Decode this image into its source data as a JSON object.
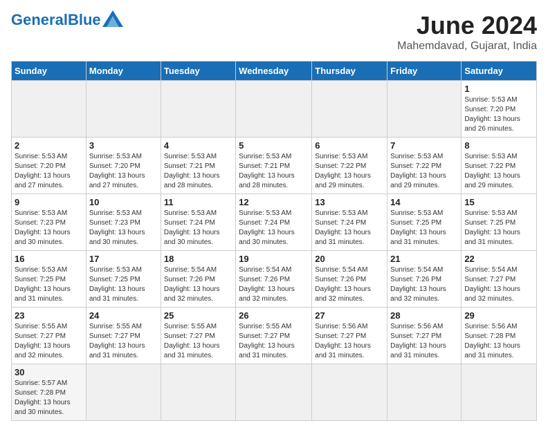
{
  "header": {
    "logo_general": "General",
    "logo_blue": "Blue",
    "month_title": "June 2024",
    "subtitle": "Mahemdavad, Gujarat, India"
  },
  "days_of_week": [
    "Sunday",
    "Monday",
    "Tuesday",
    "Wednesday",
    "Thursday",
    "Friday",
    "Saturday"
  ],
  "weeks": [
    [
      {
        "day": "",
        "info": ""
      },
      {
        "day": "",
        "info": ""
      },
      {
        "day": "",
        "info": ""
      },
      {
        "day": "",
        "info": ""
      },
      {
        "day": "",
        "info": ""
      },
      {
        "day": "",
        "info": ""
      },
      {
        "day": "1",
        "info": "Sunrise: 5:53 AM\nSunset: 7:20 PM\nDaylight: 13 hours\nand 26 minutes."
      }
    ],
    [
      {
        "day": "2",
        "info": "Sunrise: 5:53 AM\nSunset: 7:20 PM\nDaylight: 13 hours\nand 27 minutes."
      },
      {
        "day": "3",
        "info": "Sunrise: 5:53 AM\nSunset: 7:20 PM\nDaylight: 13 hours\nand 27 minutes."
      },
      {
        "day": "4",
        "info": "Sunrise: 5:53 AM\nSunset: 7:21 PM\nDaylight: 13 hours\nand 28 minutes."
      },
      {
        "day": "5",
        "info": "Sunrise: 5:53 AM\nSunset: 7:21 PM\nDaylight: 13 hours\nand 28 minutes."
      },
      {
        "day": "6",
        "info": "Sunrise: 5:53 AM\nSunset: 7:22 PM\nDaylight: 13 hours\nand 29 minutes."
      },
      {
        "day": "7",
        "info": "Sunrise: 5:53 AM\nSunset: 7:22 PM\nDaylight: 13 hours\nand 29 minutes."
      },
      {
        "day": "8",
        "info": "Sunrise: 5:53 AM\nSunset: 7:22 PM\nDaylight: 13 hours\nand 29 minutes."
      }
    ],
    [
      {
        "day": "9",
        "info": "Sunrise: 5:53 AM\nSunset: 7:23 PM\nDaylight: 13 hours\nand 30 minutes."
      },
      {
        "day": "10",
        "info": "Sunrise: 5:53 AM\nSunset: 7:23 PM\nDaylight: 13 hours\nand 30 minutes."
      },
      {
        "day": "11",
        "info": "Sunrise: 5:53 AM\nSunset: 7:24 PM\nDaylight: 13 hours\nand 30 minutes."
      },
      {
        "day": "12",
        "info": "Sunrise: 5:53 AM\nSunset: 7:24 PM\nDaylight: 13 hours\nand 30 minutes."
      },
      {
        "day": "13",
        "info": "Sunrise: 5:53 AM\nSunset: 7:24 PM\nDaylight: 13 hours\nand 31 minutes."
      },
      {
        "day": "14",
        "info": "Sunrise: 5:53 AM\nSunset: 7:25 PM\nDaylight: 13 hours\nand 31 minutes."
      },
      {
        "day": "15",
        "info": "Sunrise: 5:53 AM\nSunset: 7:25 PM\nDaylight: 13 hours\nand 31 minutes."
      }
    ],
    [
      {
        "day": "16",
        "info": "Sunrise: 5:53 AM\nSunset: 7:25 PM\nDaylight: 13 hours\nand 31 minutes."
      },
      {
        "day": "17",
        "info": "Sunrise: 5:53 AM\nSunset: 7:25 PM\nDaylight: 13 hours\nand 31 minutes."
      },
      {
        "day": "18",
        "info": "Sunrise: 5:54 AM\nSunset: 7:26 PM\nDaylight: 13 hours\nand 32 minutes."
      },
      {
        "day": "19",
        "info": "Sunrise: 5:54 AM\nSunset: 7:26 PM\nDaylight: 13 hours\nand 32 minutes."
      },
      {
        "day": "20",
        "info": "Sunrise: 5:54 AM\nSunset: 7:26 PM\nDaylight: 13 hours\nand 32 minutes."
      },
      {
        "day": "21",
        "info": "Sunrise: 5:54 AM\nSunset: 7:26 PM\nDaylight: 13 hours\nand 32 minutes."
      },
      {
        "day": "22",
        "info": "Sunrise: 5:54 AM\nSunset: 7:27 PM\nDaylight: 13 hours\nand 32 minutes."
      }
    ],
    [
      {
        "day": "23",
        "info": "Sunrise: 5:55 AM\nSunset: 7:27 PM\nDaylight: 13 hours\nand 32 minutes."
      },
      {
        "day": "24",
        "info": "Sunrise: 5:55 AM\nSunset: 7:27 PM\nDaylight: 13 hours\nand 31 minutes."
      },
      {
        "day": "25",
        "info": "Sunrise: 5:55 AM\nSunset: 7:27 PM\nDaylight: 13 hours\nand 31 minutes."
      },
      {
        "day": "26",
        "info": "Sunrise: 5:55 AM\nSunset: 7:27 PM\nDaylight: 13 hours\nand 31 minutes."
      },
      {
        "day": "27",
        "info": "Sunrise: 5:56 AM\nSunset: 7:27 PM\nDaylight: 13 hours\nand 31 minutes."
      },
      {
        "day": "28",
        "info": "Sunrise: 5:56 AM\nSunset: 7:27 PM\nDaylight: 13 hours\nand 31 minutes."
      },
      {
        "day": "29",
        "info": "Sunrise: 5:56 AM\nSunset: 7:28 PM\nDaylight: 13 hours\nand 31 minutes."
      }
    ],
    [
      {
        "day": "30",
        "info": "Sunrise: 5:57 AM\nSunset: 7:28 PM\nDaylight: 13 hours\nand 30 minutes."
      },
      {
        "day": "",
        "info": ""
      },
      {
        "day": "",
        "info": ""
      },
      {
        "day": "",
        "info": ""
      },
      {
        "day": "",
        "info": ""
      },
      {
        "day": "",
        "info": ""
      },
      {
        "day": "",
        "info": ""
      }
    ]
  ]
}
